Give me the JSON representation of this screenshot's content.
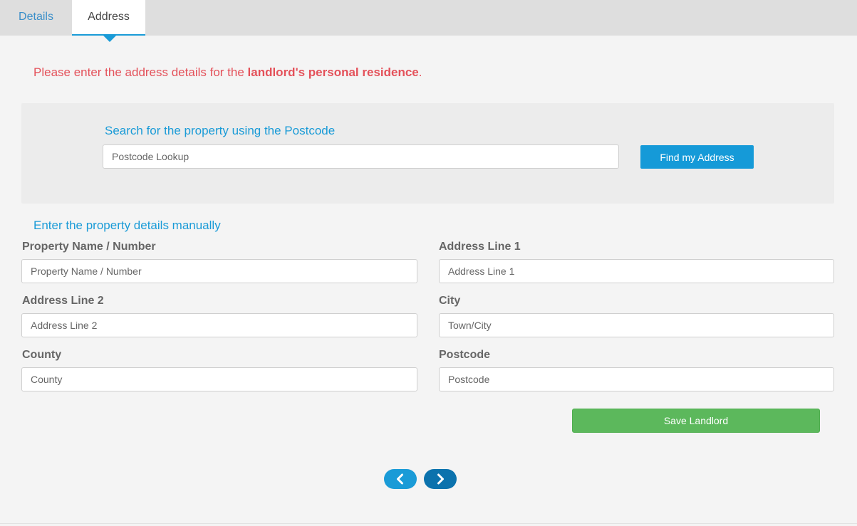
{
  "tabs": [
    {
      "label": "Details",
      "active": false
    },
    {
      "label": "Address",
      "active": true
    }
  ],
  "intro": {
    "prefix": "Please enter the address details for the ",
    "emphasis": "landlord's personal residence",
    "suffix": "."
  },
  "search": {
    "title": "Search for the property using the Postcode",
    "placeholder": "Postcode Lookup",
    "value": "",
    "button_label": "Find my Address"
  },
  "manual": {
    "title": "Enter the property details manually",
    "fields": {
      "property_name": {
        "label": "Property Name / Number",
        "placeholder": "Property Name / Number",
        "value": ""
      },
      "address_line_1": {
        "label": "Address Line 1",
        "placeholder": "Address Line 1",
        "value": ""
      },
      "address_line_2": {
        "label": "Address Line 2",
        "placeholder": "Address Line 2",
        "value": ""
      },
      "city": {
        "label": "City",
        "placeholder": "Town/City",
        "value": ""
      },
      "county": {
        "label": "County",
        "placeholder": "County",
        "value": ""
      },
      "postcode": {
        "label": "Postcode",
        "placeholder": "Postcode",
        "value": ""
      }
    }
  },
  "actions": {
    "save_label": "Save Landlord"
  },
  "pagination": {
    "prev_icon": "chevron-left-icon",
    "next_icon": "chevron-right-icon"
  },
  "colors": {
    "accent": "#1a9bd7",
    "alert_text": "#e4515a",
    "success": "#5cb85c",
    "nav_dark": "#0b72ad"
  }
}
